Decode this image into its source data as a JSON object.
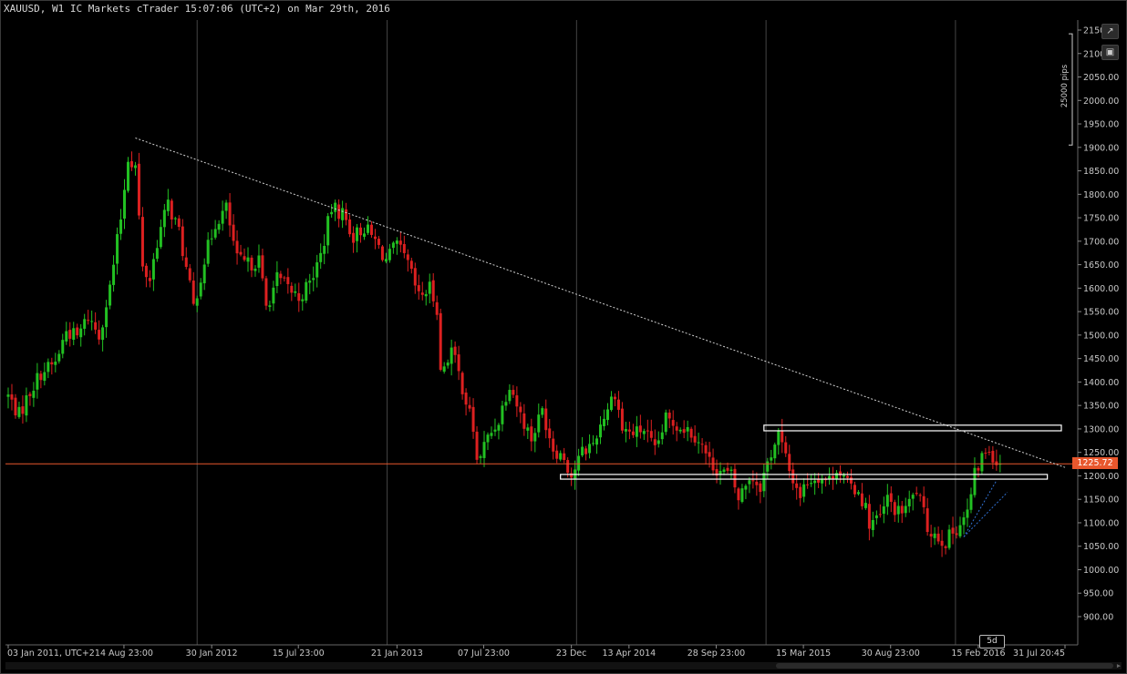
{
  "title": "XAUUSD, W1 IC Markets cTrader 15:07:06 (UTC+2) on Mar 29th, 2016",
  "current_price_label": "1225.72",
  "period_badge": "5d",
  "pips_label": "25000 pips",
  "icons": {
    "expand": "expand-icon",
    "camera": "camera-icon"
  },
  "colors": {
    "up": "#22c022",
    "down": "#dc2020",
    "price_line": "#e8572d",
    "grid": "#444444",
    "axis_text": "#c8c8c8",
    "trendline": "#d0d0d0",
    "zone": "#ffffff",
    "projection": "#3070d0"
  },
  "chart_data": {
    "type": "candlestick",
    "title": "XAUUSD, W1 IC Markets cTrader 15:07:06 (UTC+2) on Mar 29th, 2016",
    "xlabel": "",
    "ylabel": "",
    "ylim": [
      855,
      2163
    ],
    "y_ticks": [
      900,
      950,
      1000,
      1050,
      1100,
      1150,
      1200,
      1250,
      1300,
      1350,
      1400,
      1450,
      1500,
      1550,
      1600,
      1650,
      1700,
      1750,
      1800,
      1850,
      1900,
      1950,
      2000,
      2050,
      2100,
      2150
    ],
    "x_ticks": [
      "03 Jan 2011, UTC+2",
      "14 Aug 23:00",
      "30 Jan 2012",
      "15 Jul 23:00",
      "21 Jan 2013",
      "07 Jul 23:00",
      "23 Dec",
      "13 Apr 2014",
      "28 Sep 23:00",
      "15 Mar 2015",
      "30 Aug 23:00",
      "15 Feb 2016",
      "31 Jul 20:45"
    ],
    "period_separators": [
      "2012",
      "2013",
      "2014",
      "2015",
      "2016"
    ],
    "current_price": 1225.72,
    "anchors": [
      [
        "2011-01-03",
        1370
      ],
      [
        "2011-01-24",
        1330
      ],
      [
        "2011-02-14",
        1380
      ],
      [
        "2011-03-07",
        1420
      ],
      [
        "2011-04-04",
        1440
      ],
      [
        "2011-04-25",
        1510
      ],
      [
        "2011-05-16",
        1495
      ],
      [
        "2011-06-06",
        1540
      ],
      [
        "2011-06-27",
        1500
      ],
      [
        "2011-07-18",
        1600
      ],
      [
        "2011-08-08",
        1750
      ],
      [
        "2011-08-22",
        1880
      ],
      [
        "2011-09-05",
        1860
      ],
      [
        "2011-09-19",
        1640
      ],
      [
        "2011-10-03",
        1620
      ],
      [
        "2011-10-17",
        1700
      ],
      [
        "2011-11-07",
        1780
      ],
      [
        "2011-11-28",
        1720
      ],
      [
        "2011-12-19",
        1600
      ],
      [
        "2011-12-26",
        1560
      ],
      [
        "2012-01-16",
        1660
      ],
      [
        "2012-02-06",
        1740
      ],
      [
        "2012-02-27",
        1770
      ],
      [
        "2012-03-19",
        1660
      ],
      [
        "2012-04-09",
        1650
      ],
      [
        "2012-04-30",
        1660
      ],
      [
        "2012-05-14",
        1560
      ],
      [
        "2012-06-04",
        1620
      ],
      [
        "2012-06-25",
        1600
      ],
      [
        "2012-07-16",
        1580
      ],
      [
        "2012-08-06",
        1610
      ],
      [
        "2012-08-27",
        1670
      ],
      [
        "2012-09-17",
        1770
      ],
      [
        "2012-10-08",
        1760
      ],
      [
        "2012-10-29",
        1710
      ],
      [
        "2012-11-19",
        1730
      ],
      [
        "2012-12-10",
        1700
      ],
      [
        "2012-12-31",
        1660
      ],
      [
        "2013-01-21",
        1690
      ],
      [
        "2013-02-11",
        1650
      ],
      [
        "2013-03-04",
        1580
      ],
      [
        "2013-03-25",
        1600
      ],
      [
        "2013-04-08",
        1560
      ],
      [
        "2013-04-15",
        1420
      ],
      [
        "2013-05-06",
        1470
      ],
      [
        "2013-05-27",
        1390
      ],
      [
        "2013-06-17",
        1300
      ],
      [
        "2013-06-24",
        1230
      ],
      [
        "2013-07-15",
        1280
      ],
      [
        "2013-08-05",
        1320
      ],
      [
        "2013-08-26",
        1400
      ],
      [
        "2013-09-16",
        1330
      ],
      [
        "2013-10-07",
        1280
      ],
      [
        "2013-10-28",
        1340
      ],
      [
        "2013-11-18",
        1260
      ],
      [
        "2013-12-09",
        1240
      ],
      [
        "2013-12-23",
        1200
      ],
      [
        "2014-01-13",
        1250
      ],
      [
        "2014-02-03",
        1270
      ],
      [
        "2014-02-24",
        1330
      ],
      [
        "2014-03-17",
        1380
      ],
      [
        "2014-03-31",
        1300
      ],
      [
        "2014-04-21",
        1290
      ],
      [
        "2014-05-12",
        1300
      ],
      [
        "2014-06-02",
        1250
      ],
      [
        "2014-06-23",
        1320
      ],
      [
        "2014-07-14",
        1310
      ],
      [
        "2014-08-04",
        1300
      ],
      [
        "2014-08-25",
        1280
      ],
      [
        "2014-09-15",
        1230
      ],
      [
        "2014-10-06",
        1210
      ],
      [
        "2014-10-27",
        1200
      ],
      [
        "2014-11-10",
        1150
      ],
      [
        "2014-12-01",
        1200
      ],
      [
        "2014-12-22",
        1180
      ],
      [
        "2015-01-12",
        1250
      ],
      [
        "2015-01-26",
        1290
      ],
      [
        "2015-02-16",
        1210
      ],
      [
        "2015-03-09",
        1160
      ],
      [
        "2015-03-23",
        1190
      ],
      [
        "2015-04-13",
        1200
      ],
      [
        "2015-05-04",
        1190
      ],
      [
        "2015-05-18",
        1220
      ],
      [
        "2015-06-08",
        1180
      ],
      [
        "2015-06-29",
        1170
      ],
      [
        "2015-07-13",
        1130
      ],
      [
        "2015-07-20",
        1100
      ],
      [
        "2015-08-10",
        1110
      ],
      [
        "2015-08-24",
        1150
      ],
      [
        "2015-09-14",
        1120
      ],
      [
        "2015-10-05",
        1140
      ],
      [
        "2015-10-19",
        1170
      ],
      [
        "2015-11-09",
        1090
      ],
      [
        "2015-11-30",
        1070
      ],
      [
        "2015-12-14",
        1060
      ],
      [
        "2016-01-04",
        1090
      ],
      [
        "2016-01-25",
        1120
      ],
      [
        "2016-02-08",
        1200
      ],
      [
        "2016-02-22",
        1240
      ],
      [
        "2016-03-07",
        1260
      ],
      [
        "2016-03-21",
        1230
      ],
      [
        "2016-03-28",
        1225.72
      ]
    ],
    "trendline": [
      [
        "2011-09-05",
        1920
      ],
      [
        "2016-07-31",
        1218
      ]
    ],
    "zones": [
      {
        "from": "2014-12-29",
        "to": "2016-07-24",
        "low": 1296,
        "high": 1308
      },
      {
        "from": "2013-12-02",
        "to": "2016-06-27",
        "low": 1193,
        "high": 1203
      }
    ],
    "projections": [
      {
        "from": [
          "2016-01-18",
          1070
        ],
        "to": [
          "2016-03-21",
          1190
        ]
      },
      {
        "from": [
          "2016-01-18",
          1070
        ],
        "to": [
          "2016-04-11",
          1165
        ]
      }
    ]
  }
}
